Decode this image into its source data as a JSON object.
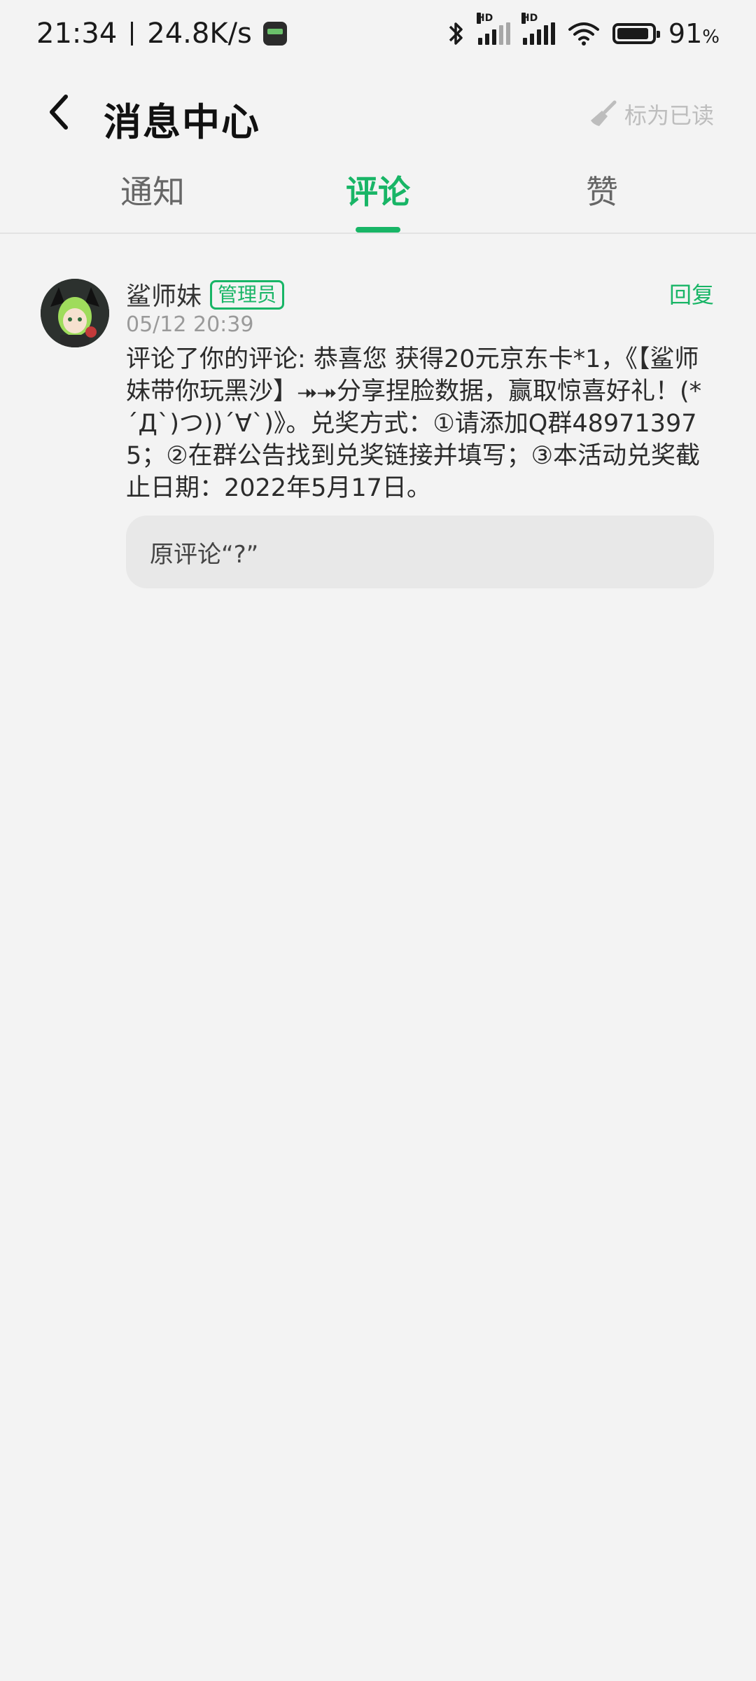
{
  "status_bar": {
    "time": "21:34",
    "net_speed": "24.8K/s",
    "battery": "91",
    "battery_unit": "%",
    "battery_level": 0.91,
    "icons": [
      "bluetooth-icon",
      "hd-signal-icon",
      "hd-signal-icon",
      "wifi-icon",
      "battery-icon"
    ]
  },
  "header": {
    "title": "消息中心",
    "mark_read": "标为已读"
  },
  "tabs": [
    {
      "label": "通知",
      "active": false
    },
    {
      "label": "评论",
      "active": true
    },
    {
      "label": "赞",
      "active": false
    }
  ],
  "comment": {
    "user": "鲨师妹",
    "badge": "管理员",
    "reply": "回复",
    "time": "05/12 20:39",
    "body": "评论了你的评论: 恭喜您 获得20元京东卡*1，《【鲨师妹带你玩黑沙】⯮⯮分享捏脸数据，赢取惊喜好礼！(*´Д`)つ))´∀`)》。兑奖方式：①请添加Q群489713975；②在群公告找到兑奖链接并填写；③本活动兑奖截止日期：2022年5月17日。",
    "original": "原评论“?”"
  },
  "colors": {
    "accent": "#18b566",
    "background": "#f3f3f3",
    "muted": "#9a9a9a"
  }
}
